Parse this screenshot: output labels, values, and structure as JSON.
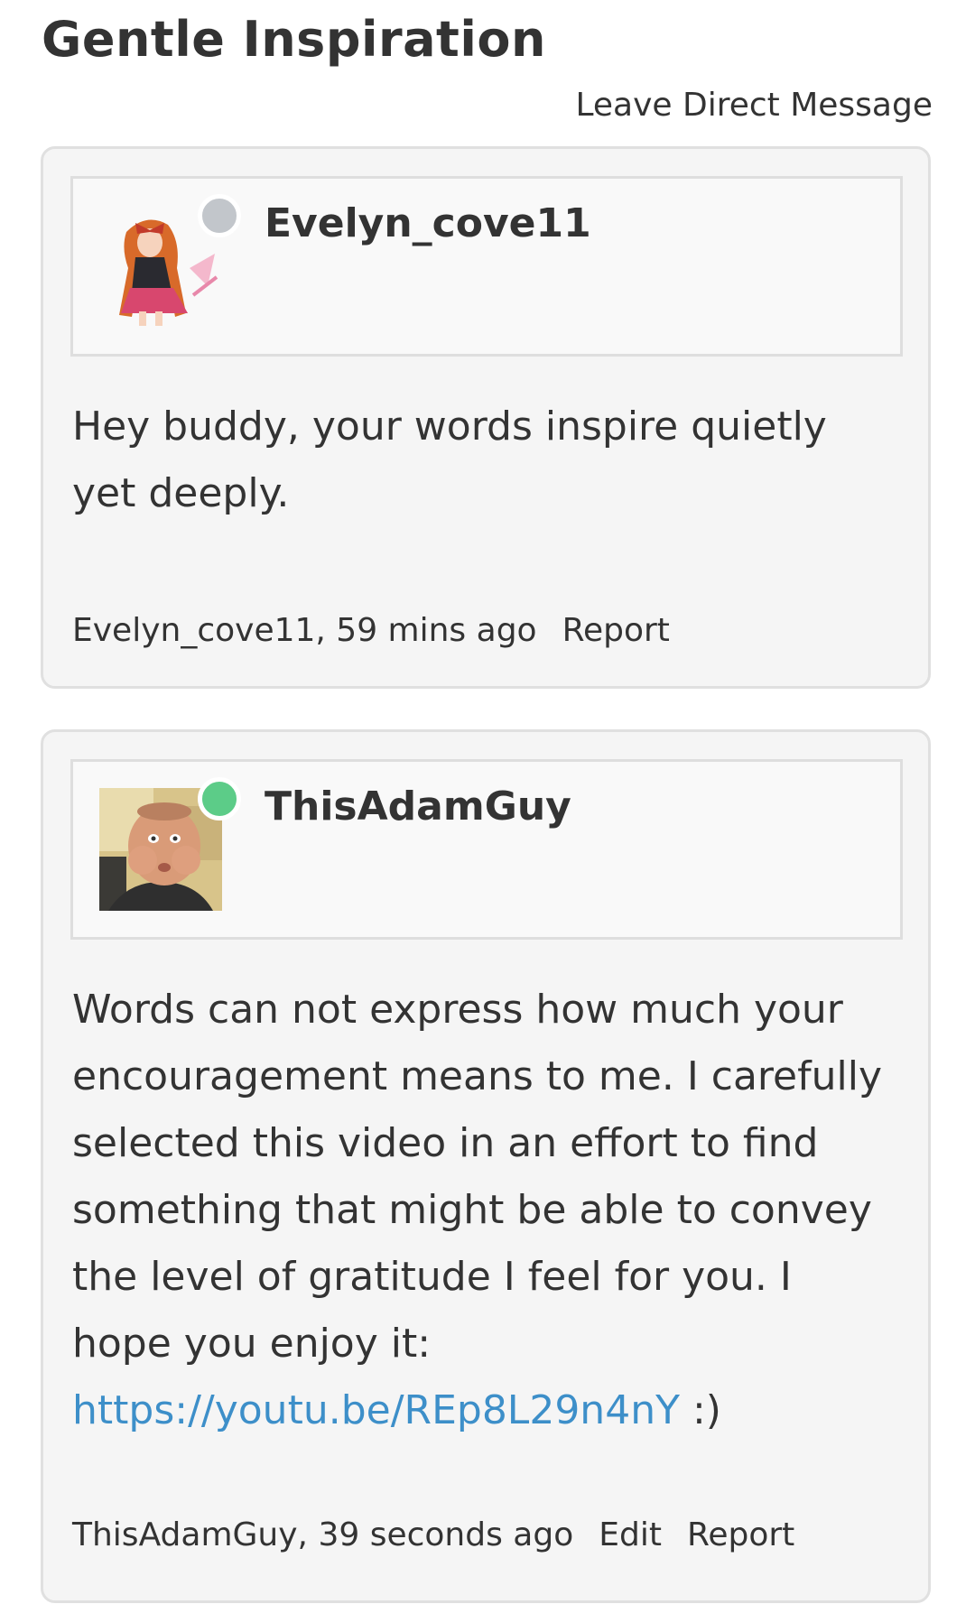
{
  "page": {
    "title": "Gentle Inspiration",
    "direct_message_label": "Leave Direct Message"
  },
  "comments": [
    {
      "username": "Evelyn_cove11",
      "status": "offline",
      "status_color": "#c2c6cb",
      "avatar_icon": "anime-character-avatar",
      "body": "Hey buddy, your words inspire quietly yet deeply.",
      "meta": "Evelyn_cove11, 59 mins ago",
      "actions": [
        "Report"
      ]
    },
    {
      "username": "ThisAdamGuy",
      "status": "online",
      "status_color": "#5ccc88",
      "avatar_icon": "man-face-photo-avatar",
      "body": "Words can not express how much your encouragement means to me. I carefully selected this video in an effort to find something that might be able to convey the level of gratitude I feel for you. I hope you enjoy it:",
      "link": "https://youtu.be/REp8L29n4nY",
      "body_suffix": " :)",
      "meta": "ThisAdamGuy, 39 seconds ago",
      "actions": [
        "Edit",
        "Report"
      ]
    }
  ],
  "colors": {
    "card_background": "#f5f5f5",
    "card_border": "#e0e0e0",
    "link": "#3d8fc9",
    "text": "#333333"
  }
}
